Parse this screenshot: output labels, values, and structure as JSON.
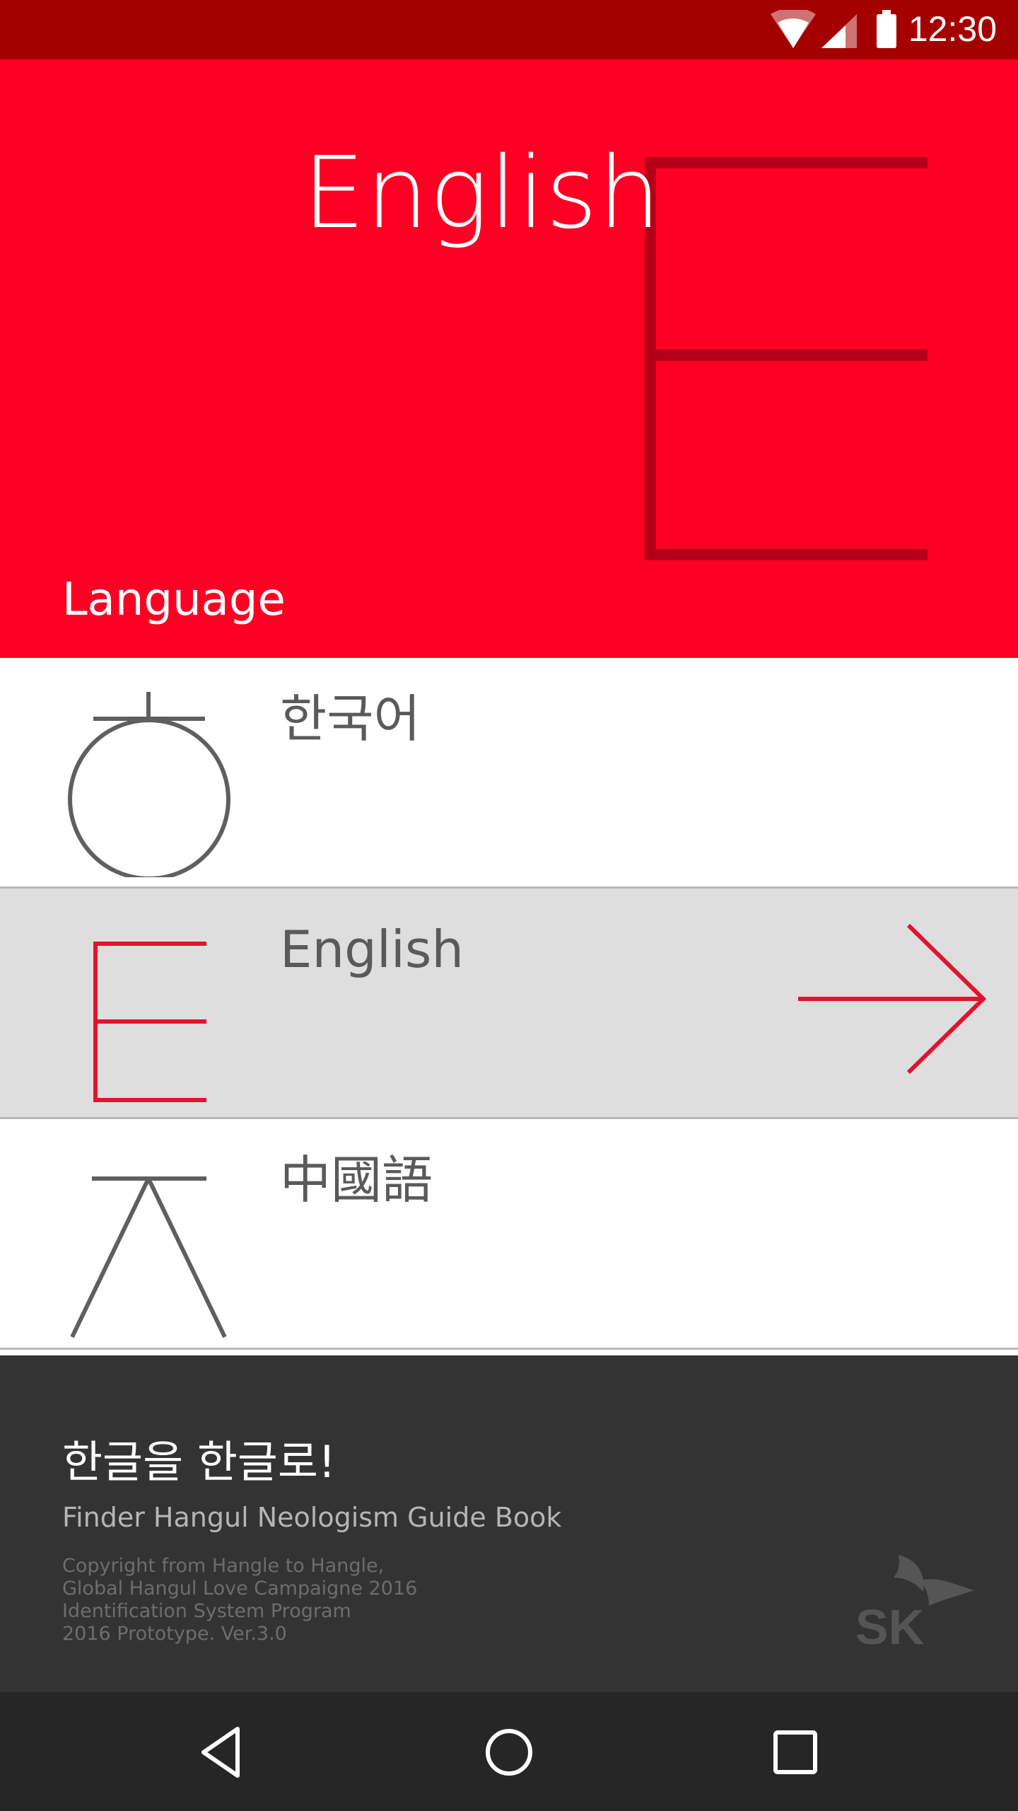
{
  "status_bar": {
    "time": "12:30",
    "icons": [
      "wifi-icon",
      "signal-icon",
      "battery-icon"
    ]
  },
  "hero": {
    "title": "English",
    "background_letter_icon": "letter-e-glyph-icon",
    "section_label": "Language",
    "color": "#fe0023"
  },
  "languages": [
    {
      "label": "한국어",
      "icon": "hieut-glyph-icon",
      "selected": false
    },
    {
      "label": "English",
      "icon": "letter-e-glyph-icon",
      "selected": true
    },
    {
      "label": "中國語",
      "icon": "jieut-glyph-icon",
      "selected": false
    }
  ],
  "selected_arrow_icon": "arrow-right-icon",
  "footer": {
    "tagline": "한글을 한글로!",
    "subtitle": "Finder Hangul Neologism Guide Book",
    "copyright_lines": [
      "Copyright from Hangle to Hangle,",
      "Global Hangul Love Campaigne 2016",
      "Identification System Program",
      "2016 Prototype. Ver.3.0"
    ],
    "logo_text": "SK"
  },
  "navigation": {
    "buttons": [
      "back-icon",
      "home-icon",
      "recents-icon"
    ]
  },
  "colors": {
    "accent": "#fe0023",
    "status_bar": "#a50000",
    "footer": "#333333",
    "navbar": "#262626",
    "selected_row": "#dedede",
    "glyph_gray": "#5f5f5f"
  }
}
